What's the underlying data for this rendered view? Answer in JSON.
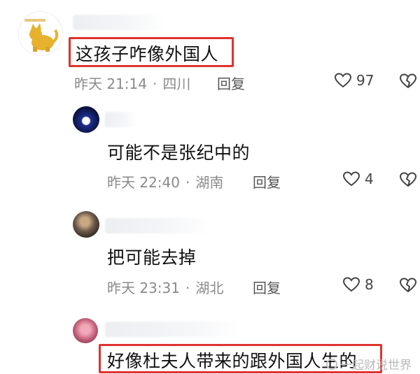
{
  "comments": [
    {
      "text": "这孩子咋像外国人",
      "time": "昨天 21:14",
      "location": "四川",
      "reply_label": "回复",
      "likes": "97",
      "highlighted": true
    },
    {
      "text": "可能不是张纪中的",
      "time": "昨天 22:40",
      "location": "湖南",
      "reply_label": "回复",
      "likes": "4",
      "highlighted": false
    },
    {
      "text": "把可能去掉",
      "time": "昨天 23:31",
      "location": "湖北",
      "reply_label": "回复",
      "likes": "8",
      "highlighted": false
    },
    {
      "text": "好像杜夫人带来的跟外国人生的",
      "highlighted": true
    }
  ],
  "separator": "·",
  "watermark": "一起财说世界",
  "colors": {
    "highlight": "#e0322f",
    "meta": "#8a8a8a",
    "text": "#111111"
  },
  "icons": {
    "like": "heart-outline-icon",
    "dislike": "broken-heart-icon"
  }
}
